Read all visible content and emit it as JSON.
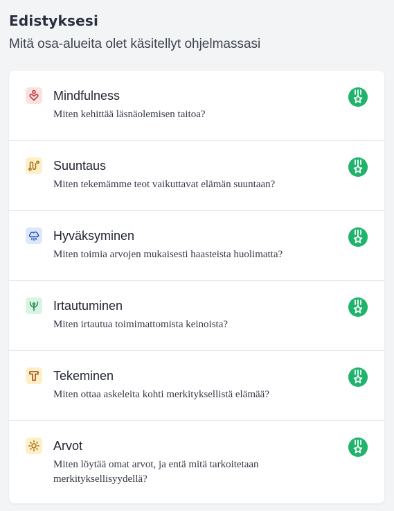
{
  "header": {
    "title": "Edistyksesi",
    "subtitle": "Mitä osa-alueita olet käsitellyt ohjelmassasi"
  },
  "topics": [
    {
      "title": "Mindfulness",
      "description": "Miten kehittää läsnäolemisen taitoa?",
      "icon": "heart-person-icon",
      "color": "#f9e1e1",
      "accent": "#c23a3a"
    },
    {
      "title": "Suuntaus",
      "description": "Miten tekemämme teot vaikuttavat elämän suuntaan?",
      "icon": "path-route-icon",
      "color": "#fdefc6",
      "accent": "#a36a0f"
    },
    {
      "title": "Hyväksyminen",
      "description": "Miten toimia arvojen mukaisesti haasteista huolimatta?",
      "icon": "rain-cloud-icon",
      "color": "#dde7fb",
      "accent": "#2f56b8"
    },
    {
      "title": "Irtautuminen",
      "description": "Miten irtautua toimimattomista keinoista?",
      "icon": "sprout-icon",
      "color": "#d8f4e4",
      "accent": "#1e8a52"
    },
    {
      "title": "Tekeminen",
      "description": "Miten ottaa askeleita kohti merkityksellistä elämää?",
      "icon": "hammer-icon",
      "color": "#fdefc6",
      "accent": "#a04a12"
    },
    {
      "title": "Arvot",
      "description": "Miten löytää omat arvot, ja entä mitä tarkoitetaan merkityksellisyydellä?",
      "icon": "sun-icon",
      "color": "#fdefc6",
      "accent": "#a36a0f"
    }
  ],
  "badge": {
    "icon": "medal-star-icon",
    "color": "#1fb36c"
  }
}
